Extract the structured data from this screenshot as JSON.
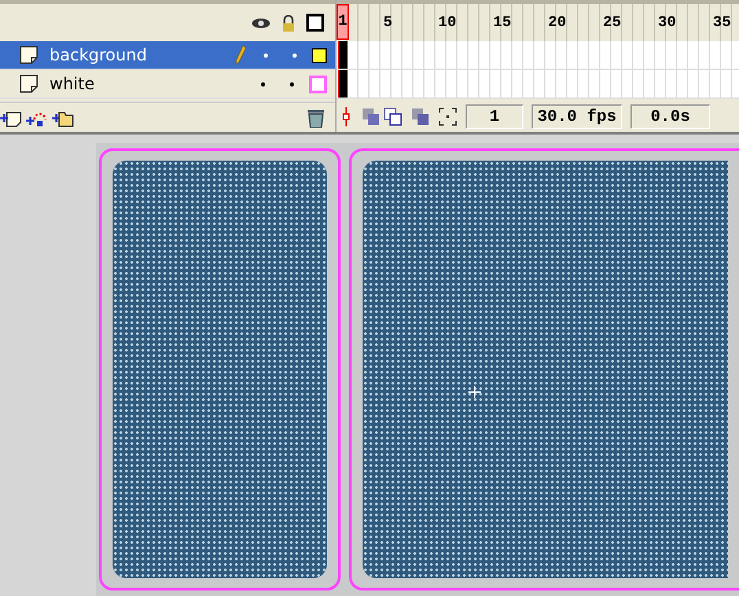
{
  "timeline": {
    "layers": [
      {
        "name": "background",
        "selected": true,
        "editing": true,
        "color": "#ffff33",
        "outline": false
      },
      {
        "name": "white",
        "selected": false,
        "editing": false,
        "color": "#ff66ff",
        "outline": true
      }
    ],
    "ruler": [
      "1",
      "5",
      "10",
      "15",
      "20",
      "25",
      "30",
      "35"
    ],
    "current_frame": "1",
    "frame_rate": "30.0 fps",
    "elapsed_time": "0.0s"
  },
  "stage": {
    "crosshair": true
  }
}
